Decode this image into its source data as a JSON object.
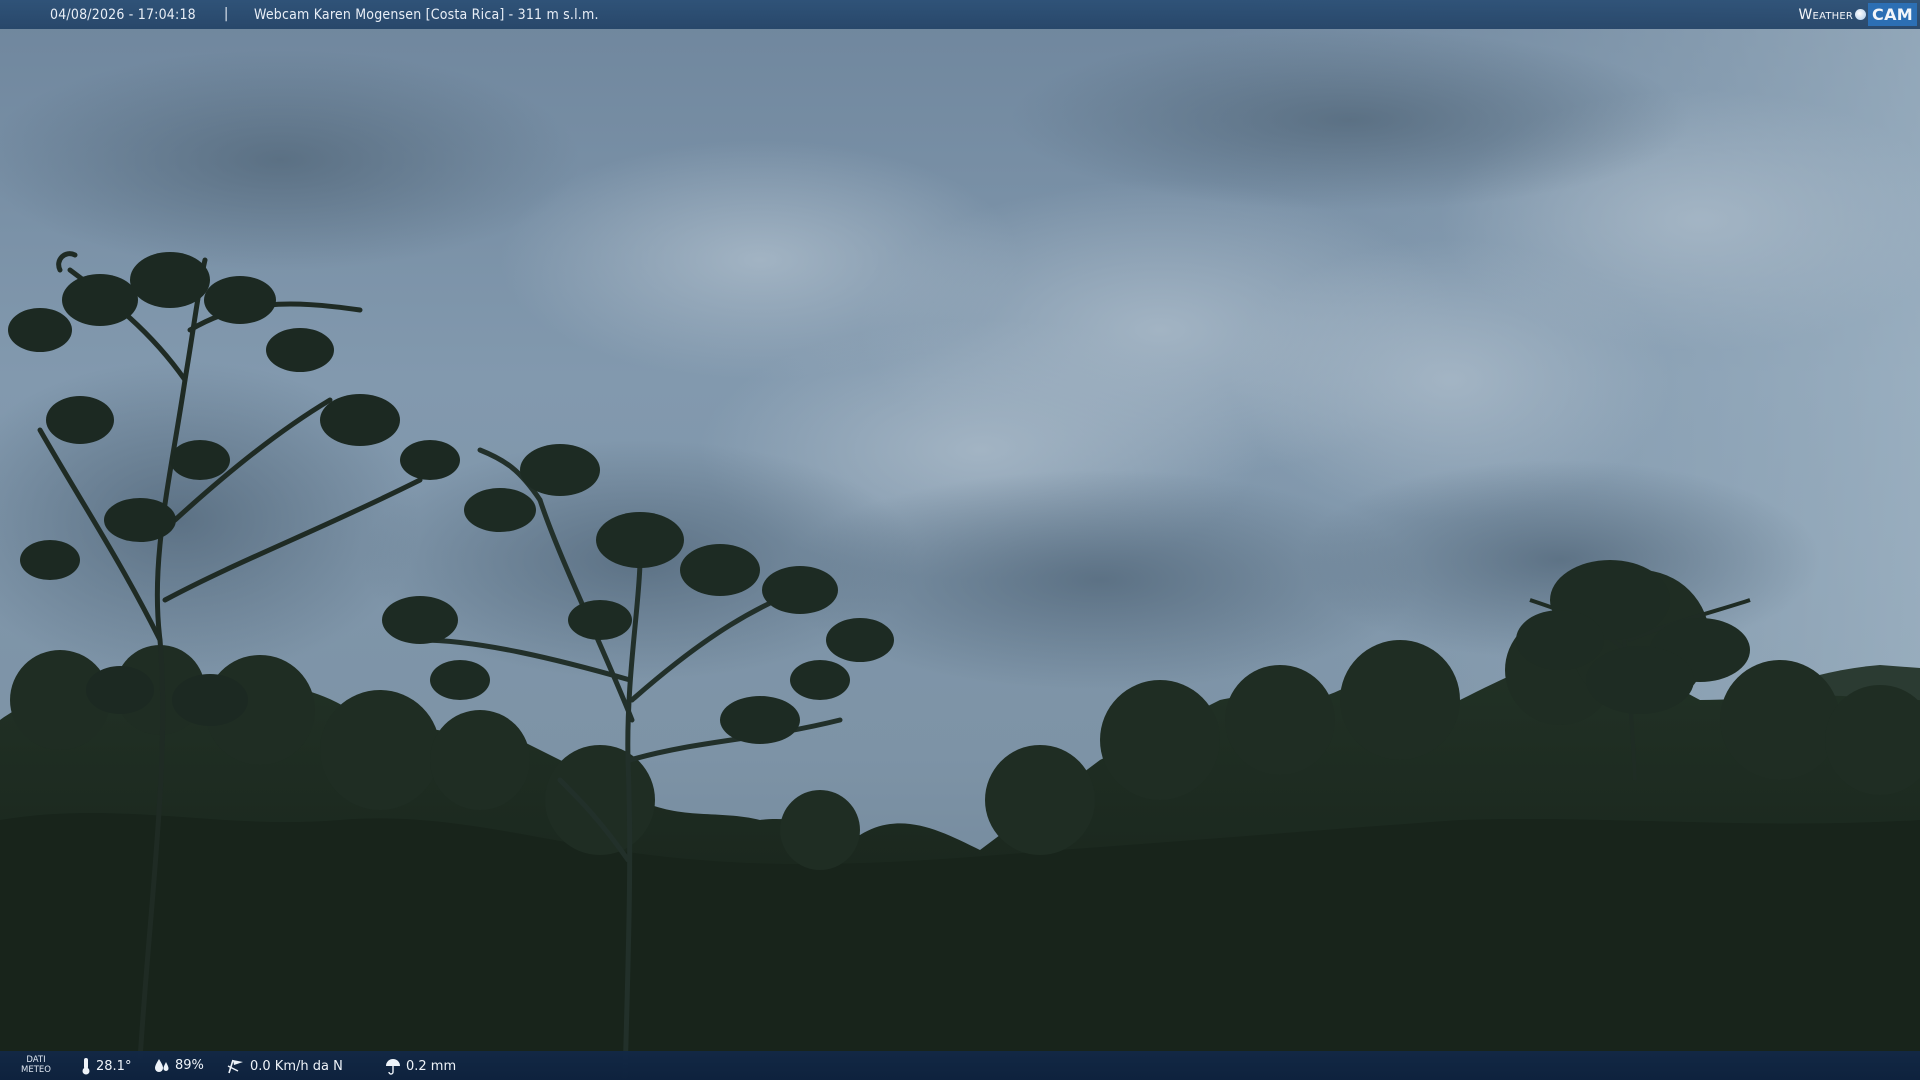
{
  "overlay": {
    "datetime": "04/08/2026 - 17:04:18",
    "separator": "|",
    "caption": "Webcam Karen Mogensen [Costa Rica]  - 311 m s.l.m.",
    "brand_left": "Weather",
    "brand_right": "CAM"
  },
  "weather": {
    "label_line1": "DATI",
    "label_line2": "METEO",
    "temperature": "28.1°",
    "humidity": "89%",
    "wind": "0.0 Km/h da N",
    "rain": "0.2 mm"
  },
  "colors": {
    "top_bar": "#2c5076",
    "bottom_bar": "#122846",
    "brand_accent": "#2c6fb4",
    "sky": "#7d93a8",
    "foliage": "#1c2a20"
  }
}
